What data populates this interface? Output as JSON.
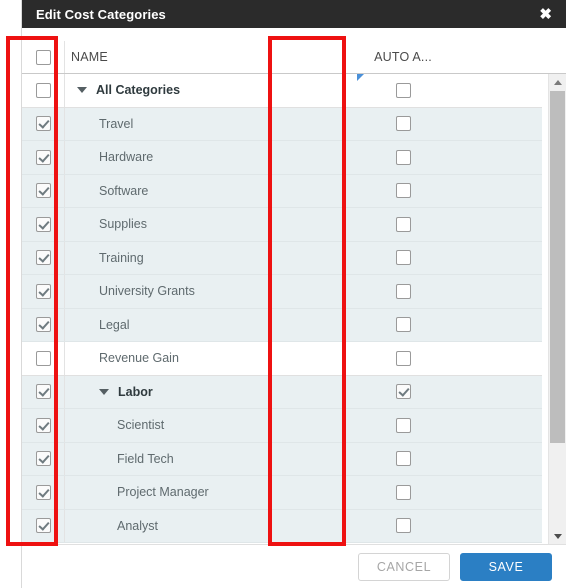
{
  "dialog": {
    "title": "Edit Cost Categories",
    "close_icon": "close-icon",
    "close_glyph": "✖"
  },
  "grid": {
    "select_all_checked": false,
    "columns": [
      {
        "key": "select",
        "label": ""
      },
      {
        "key": "name",
        "label": "NAME"
      },
      {
        "key": "auto_a",
        "label": "AUTO A..."
      }
    ],
    "rows": [
      {
        "name": "All Categories",
        "indent": 0,
        "bold": true,
        "twisty": "chevron-down-icon",
        "selected": false,
        "auto_a": false,
        "white": true,
        "corner_mark": true
      },
      {
        "name": "Travel",
        "indent": 1,
        "bold": false,
        "twisty": null,
        "selected": true,
        "auto_a": false,
        "white": false,
        "corner_mark": false
      },
      {
        "name": "Hardware",
        "indent": 1,
        "bold": false,
        "twisty": null,
        "selected": true,
        "auto_a": false,
        "white": false,
        "corner_mark": false
      },
      {
        "name": "Software",
        "indent": 1,
        "bold": false,
        "twisty": null,
        "selected": true,
        "auto_a": false,
        "white": false,
        "corner_mark": false
      },
      {
        "name": "Supplies",
        "indent": 1,
        "bold": false,
        "twisty": null,
        "selected": true,
        "auto_a": false,
        "white": false,
        "corner_mark": false
      },
      {
        "name": "Training",
        "indent": 1,
        "bold": false,
        "twisty": null,
        "selected": true,
        "auto_a": false,
        "white": false,
        "corner_mark": false
      },
      {
        "name": "University Grants",
        "indent": 1,
        "bold": false,
        "twisty": null,
        "selected": true,
        "auto_a": false,
        "white": false,
        "corner_mark": false
      },
      {
        "name": "Legal",
        "indent": 1,
        "bold": false,
        "twisty": null,
        "selected": true,
        "auto_a": false,
        "white": false,
        "corner_mark": false
      },
      {
        "name": "Revenue Gain",
        "indent": 1,
        "bold": false,
        "twisty": null,
        "selected": false,
        "auto_a": false,
        "white": true,
        "corner_mark": false
      },
      {
        "name": "Labor",
        "indent": 1,
        "bold": true,
        "twisty": "chevron-down-icon",
        "selected": true,
        "auto_a": true,
        "white": false,
        "corner_mark": false
      },
      {
        "name": "Scientist",
        "indent": 2,
        "bold": false,
        "twisty": null,
        "selected": true,
        "auto_a": false,
        "white": false,
        "corner_mark": false
      },
      {
        "name": "Field Tech",
        "indent": 2,
        "bold": false,
        "twisty": null,
        "selected": true,
        "auto_a": false,
        "white": false,
        "corner_mark": false
      },
      {
        "name": "Project Manager",
        "indent": 2,
        "bold": false,
        "twisty": null,
        "selected": true,
        "auto_a": false,
        "white": false,
        "corner_mark": false
      },
      {
        "name": "Analyst",
        "indent": 2,
        "bold": false,
        "twisty": null,
        "selected": true,
        "auto_a": false,
        "white": false,
        "corner_mark": false
      }
    ]
  },
  "scrollbar": {
    "up_icon": "scroll-up-arrow-icon",
    "down_icon": "scroll-down-arrow-icon"
  },
  "footer": {
    "cancel_label": "CANCEL",
    "save_label": "SAVE"
  },
  "colors": {
    "titlebar": "#2b2b2b",
    "row_selected_bg": "#e9f0f2",
    "row_plain_bg": "#ffffff",
    "save_button": "#2b7fc4",
    "annotation": "#ee1111",
    "corner_mark": "#4a90d9"
  }
}
